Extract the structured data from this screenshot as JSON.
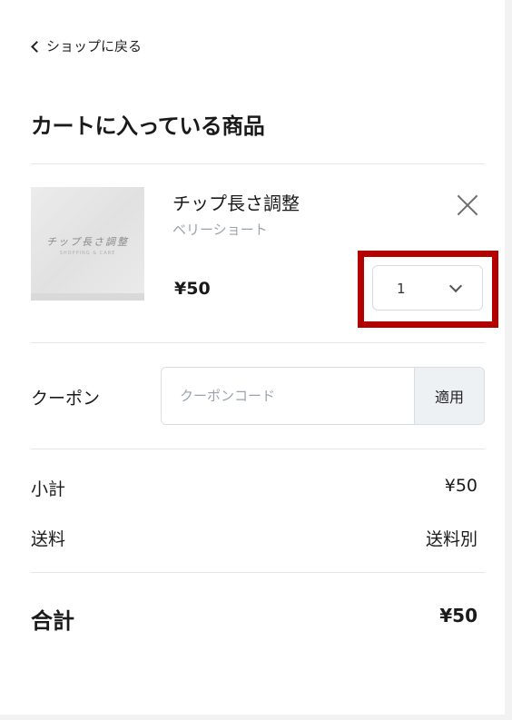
{
  "back_link": "ショップに戻る",
  "cart_title": "カートに入っている商品",
  "item": {
    "thumbnail_title": "チップ長さ調整",
    "thumbnail_subtitle": "SHOPPING & CARE",
    "name": "チップ長さ調整",
    "variant": "ベリーショート",
    "price": "¥50",
    "quantity": "1"
  },
  "coupon": {
    "label": "クーポン",
    "placeholder": "クーポンコード",
    "apply_label": "適用"
  },
  "summary": {
    "subtotal_label": "小計",
    "subtotal_value": "¥50",
    "shipping_label": "送料",
    "shipping_value": "送料別",
    "total_label": "合計",
    "total_value": "¥50"
  },
  "colors": {
    "highlight": "#b50000",
    "variant_text": "#9aa3ad"
  }
}
